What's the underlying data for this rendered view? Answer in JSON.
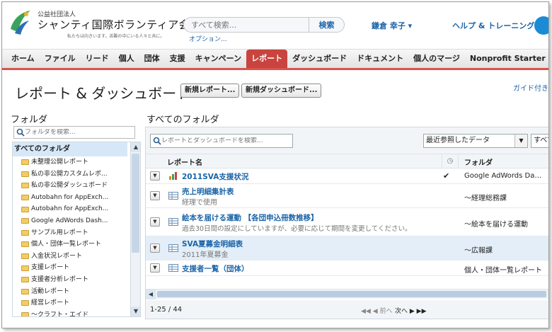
{
  "header": {
    "org_type": "公益社団法人",
    "org_name": "シャンティ国際ボランティア会",
    "tagline": "私たちは向きいます。苦難の中にいる人々と共に。",
    "search_placeholder": "すべて検索...",
    "search_button": "検索",
    "options_link": "オプション...",
    "user_name": "鎌倉 幸子 ▾",
    "help_link": "ヘルプ & トレーニング"
  },
  "tabs": [
    {
      "label": "ホーム",
      "active": false
    },
    {
      "label": "ファイル",
      "active": false
    },
    {
      "label": "リード",
      "active": false
    },
    {
      "label": "個人",
      "active": false
    },
    {
      "label": "団体",
      "active": false
    },
    {
      "label": "支援",
      "active": false
    },
    {
      "label": "キャンペーン",
      "active": false
    },
    {
      "label": "レポート",
      "active": true
    },
    {
      "label": "ダッシュボード",
      "active": false
    },
    {
      "label": "ドキュメント",
      "active": false
    },
    {
      "label": "個人のマージ",
      "active": false
    },
    {
      "label": "Nonprofit Starter Pack",
      "active": false
    }
  ],
  "page": {
    "title": "レポート & ダッシュボード",
    "new_report_button": "新規レポート...",
    "new_dashboard_button": "新規ダッシュボード...",
    "guide_link": "ガイド付きツアー"
  },
  "folders": {
    "heading": "フォルダ",
    "search_placeholder": "フォルダを検索...",
    "all_label": "すべてのフォルダ",
    "items": [
      "未整理公開レポート",
      "私の非公開カスタムレポ...",
      "私の非公開ダッシュボード",
      "Autobahn for AppExch...",
      "Autobahn for AppExch...",
      "Google AdWords Dash...",
      "サンプル用レポート",
      "個人・団体一覧レポート",
      "入金状況レポート",
      "支援レポート",
      "支援者分析レポート",
      "活動レポート",
      "経営レポート",
      "～クラフト・エイド"
    ]
  },
  "list": {
    "heading": "すべてのフォルダ",
    "search_placeholder": "レポートとダッシュボードを検索...",
    "filter_value": "最近参照したデータ",
    "filter_more": "すべて",
    "col_name": "レポート名",
    "col_folder": "フォルダ",
    "rows": [
      {
        "name": "2011SVA支援状況",
        "desc": "",
        "checked": "✔",
        "folder": "Google AdWords Da…",
        "highlight": false
      },
      {
        "name": "売上明細集計表",
        "desc": "経理で使用",
        "checked": "",
        "folder": "～経理総務課",
        "highlight": false
      },
      {
        "name": "絵本を届ける運動 【各団申込冊数推移】",
        "desc": "過去30日間の設定にしていますが、必要に応じて期間を変更してください。",
        "checked": "",
        "folder": "～絵本を届ける運動",
        "highlight": false
      },
      {
        "name": "SVA夏募金明細表",
        "desc": "2011年夏募金",
        "checked": "",
        "folder": "～広報課",
        "highlight": true
      },
      {
        "name": "支援者一覧（団体）",
        "desc": "",
        "checked": "",
        "folder": "個人・団体一覧レポート",
        "highlight": false
      }
    ],
    "range": "1-25 / 44",
    "prev_label": "◀◀ ◀ 前へ",
    "next_label": "次へ ▶ ▶▶"
  },
  "colors": {
    "accent_tab": "#c9443f",
    "link": "#1b64a8",
    "help_circle": "#1b8bd6"
  }
}
